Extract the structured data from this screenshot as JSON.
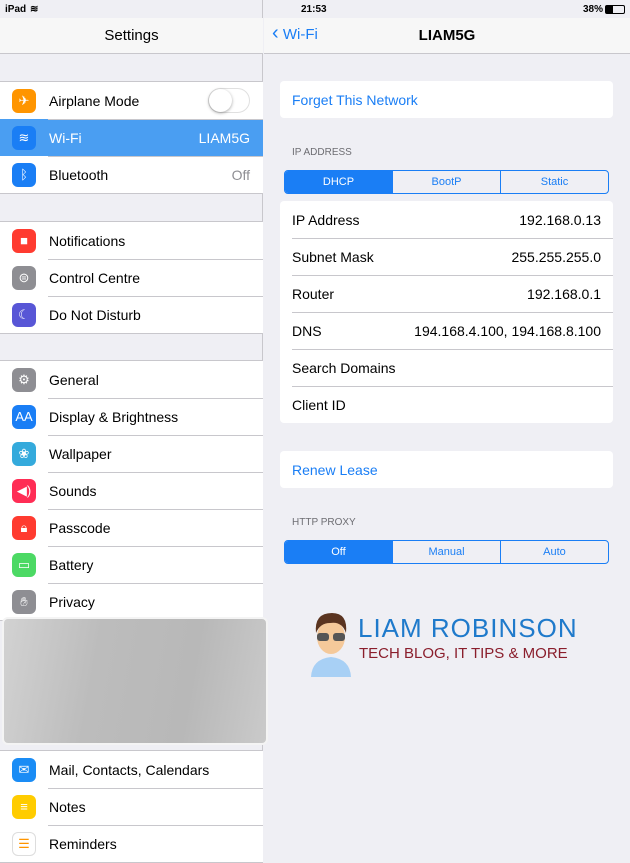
{
  "status": {
    "device": "iPad",
    "time": "21:53",
    "battery": "38%"
  },
  "left": {
    "title": "Settings",
    "groups": [
      [
        {
          "label": "Airplane Mode",
          "icon": "airplane-icon",
          "color": "#ff9500",
          "toggle": false
        },
        {
          "label": "Wi-Fi",
          "icon": "wifi-icon",
          "color": "#1a7ef5",
          "value": "LIAM5G",
          "selected": true
        },
        {
          "label": "Bluetooth",
          "icon": "bluetooth-icon",
          "color": "#1a7ef5",
          "value": "Off"
        }
      ],
      [
        {
          "label": "Notifications",
          "icon": "notifications-icon",
          "color": "#ff3b30"
        },
        {
          "label": "Control Centre",
          "icon": "control-centre-icon",
          "color": "#8e8e93"
        },
        {
          "label": "Do Not Disturb",
          "icon": "moon-icon",
          "color": "#5856d6"
        }
      ],
      [
        {
          "label": "General",
          "icon": "gear-icon",
          "color": "#8e8e93"
        },
        {
          "label": "Display & Brightness",
          "icon": "display-icon",
          "color": "#1a7ef5"
        },
        {
          "label": "Wallpaper",
          "icon": "wallpaper-icon",
          "color": "#34aadc"
        },
        {
          "label": "Sounds",
          "icon": "speaker-icon",
          "color": "#ff2d55"
        },
        {
          "label": "Passcode",
          "icon": "lock-icon",
          "color": "#ff3b30"
        },
        {
          "label": "Battery",
          "icon": "battery-icon",
          "color": "#4cd964"
        },
        {
          "label": "Privacy",
          "icon": "hand-icon",
          "color": "#8e8e93"
        }
      ],
      [
        {
          "label": "Mail, Contacts, Calendars",
          "icon": "mail-icon",
          "color": "#1a8cf5"
        },
        {
          "label": "Notes",
          "icon": "notes-icon",
          "color": "#ffcc00"
        },
        {
          "label": "Reminders",
          "icon": "reminders-icon",
          "color": "#ffffff"
        }
      ]
    ]
  },
  "right": {
    "back": "Wi-Fi",
    "title": "LIAM5G",
    "forget": "Forget This Network",
    "ip_section": "IP ADDRESS",
    "ip_modes": [
      "DHCP",
      "BootP",
      "Static"
    ],
    "ip_selected": 0,
    "rows": [
      {
        "label": "IP Address",
        "value": "192.168.0.13"
      },
      {
        "label": "Subnet Mask",
        "value": "255.255.255.0"
      },
      {
        "label": "Router",
        "value": "192.168.0.1"
      },
      {
        "label": "DNS",
        "value": "194.168.4.100, 194.168.8.100"
      },
      {
        "label": "Search Domains",
        "value": ""
      },
      {
        "label": "Client ID",
        "value": ""
      }
    ],
    "renew": "Renew Lease",
    "proxy_section": "HTTP PROXY",
    "proxy_modes": [
      "Off",
      "Manual",
      "Auto"
    ],
    "proxy_selected": 0
  },
  "watermark": {
    "name": "LIAM ROBINSON",
    "tagline": "TECH BLOG, IT TIPS & MORE"
  },
  "colors": {
    "accent": "#1a7ef5",
    "selected_row": "#4a9ef2"
  }
}
